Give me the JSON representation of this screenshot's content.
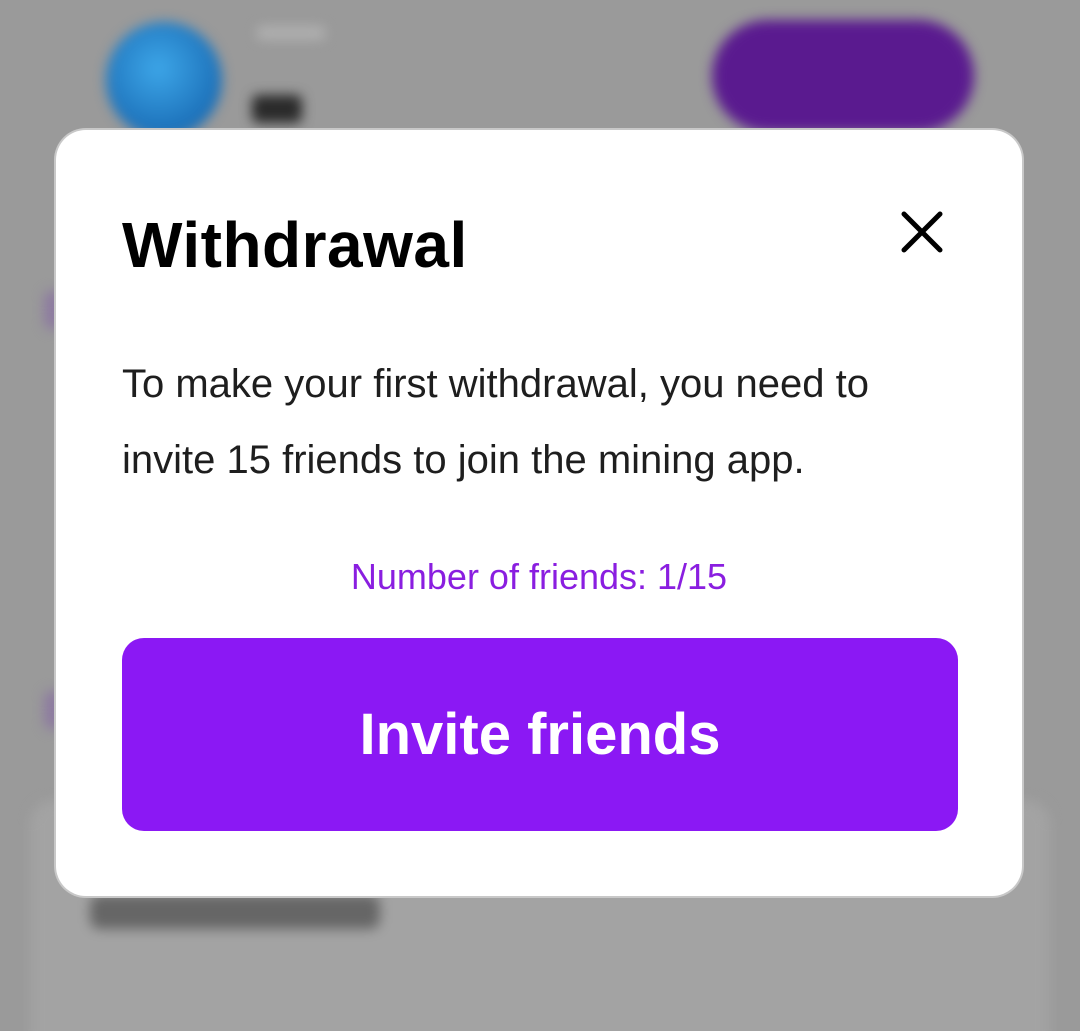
{
  "modal": {
    "title": "Withdrawal",
    "body_text": "To make your first withdrawal, you need to invite 15 friends to join the mining app.",
    "friends_count_text": "Number of friends: 1/15",
    "invite_button_label": "Invite friends",
    "close_icon": "close-icon"
  },
  "colors": {
    "accent": "#8b18f4",
    "friends_count": "#8a1ee0",
    "overlay": "#9a9a9a"
  }
}
